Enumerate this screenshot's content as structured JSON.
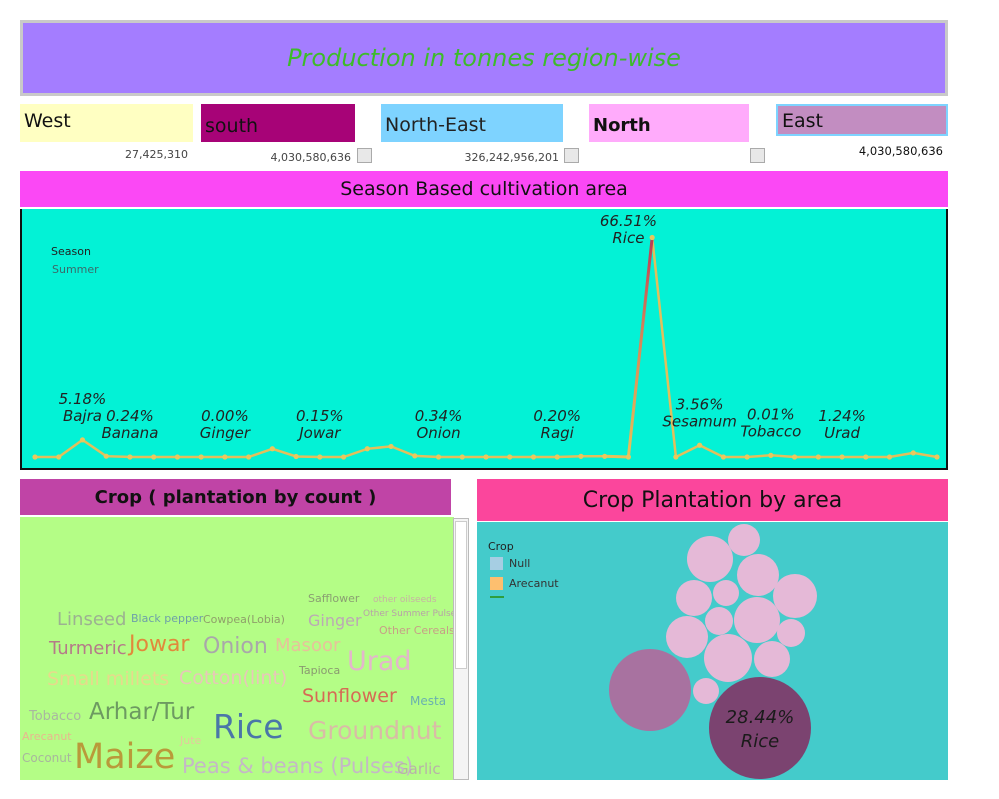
{
  "title": "Production in tonnes region-wise",
  "regions": [
    {
      "name": "West",
      "value": "27,425,310",
      "color": "#ffffc2"
    },
    {
      "name": "south",
      "value": "4,030,580,636",
      "color": "#a70377"
    },
    {
      "name": "North-East",
      "value": "326,242,956,201",
      "color": "#7ed3ff"
    },
    {
      "name": "North",
      "value": "",
      "color": "#ffabfb"
    },
    {
      "name": "East",
      "value": "4,030,580,636",
      "color": "#c28dc1"
    }
  ],
  "season_chart": {
    "header": "Season Based cultivation area",
    "legend_title": "Season",
    "legend_item": "Summer"
  },
  "chart_data": [
    {
      "type": "line",
      "title": "Season Based cultivation area",
      "ylabel": "",
      "xlabel": "",
      "ylim": [
        0,
        70
      ],
      "series": [
        {
          "values": [
            0,
            0,
            5.18,
            0.24,
            0,
            0,
            0,
            0,
            0,
            0,
            2.5,
            0.15,
            0,
            0,
            2.5,
            3.2,
            0.34,
            0,
            0,
            0,
            0,
            0,
            0,
            0.2,
            0.2,
            0,
            66.51,
            0,
            3.56,
            0,
            0,
            0.5,
            0,
            0,
            0.01,
            0,
            0,
            1.24,
            0
          ]
        }
      ],
      "labels": [
        {
          "index": 2,
          "percent": "5.18%",
          "crop": "Bajra"
        },
        {
          "index": 4,
          "percent": "0.24%",
          "crop": "Banana"
        },
        {
          "index": 8,
          "percent": "0.00%",
          "crop": "Ginger"
        },
        {
          "index": 12,
          "percent": "0.15%",
          "crop": "Jowar"
        },
        {
          "index": 17,
          "percent": "0.34%",
          "crop": "Onion"
        },
        {
          "index": 22,
          "percent": "0.20%",
          "crop": "Ragi"
        },
        {
          "index": 25,
          "percent": "66.51%",
          "crop": "Rice"
        },
        {
          "index": 28,
          "percent": "3.56%",
          "crop": "Sesamum"
        },
        {
          "index": 31,
          "percent": "0.01%",
          "crop": "Tobacco"
        },
        {
          "index": 34,
          "percent": "1.24%",
          "crop": "Urad"
        }
      ]
    },
    {
      "type": "bubble",
      "title": "Crop Plantation by area",
      "legend_title": "Crop",
      "legend": [
        {
          "name": "Null",
          "color": "#a6cee3"
        },
        {
          "name": "Arecanut",
          "color": "#fdbf6f"
        }
      ],
      "highlight": {
        "percent": "28.44%",
        "crop": "Rice"
      }
    }
  ],
  "crop_count": {
    "header": "Crop ( plantation by count )",
    "words": [
      {
        "text": "Safflower",
        "color": "#8a9f72"
      },
      {
        "text": "other oilseeds",
        "color": "#c7b2a3"
      },
      {
        "text": "Other Summer Pulses",
        "color": "#b8a2a7"
      },
      {
        "text": "Linseed",
        "color": "#9cb191"
      },
      {
        "text": "Black pepper",
        "color": "#6ea0a8"
      },
      {
        "text": "Cowpea(Lobia)",
        "color": "#8f9f6a"
      },
      {
        "text": "Ginger",
        "color": "#bba9b4"
      },
      {
        "text": "Other Cereals",
        "color": "#c79f86"
      },
      {
        "text": "Turmeric",
        "color": "#b57a88"
      },
      {
        "text": "Jowar",
        "color": "#e1893b"
      },
      {
        "text": "Onion",
        "color": "#a9a7aa"
      },
      {
        "text": "Masoor",
        "color": "#e6c29a"
      },
      {
        "text": "Urad",
        "color": "#e3b6cb"
      },
      {
        "text": "Tapioca",
        "color": "#8a9a70"
      },
      {
        "text": "Small millets",
        "color": "#e6da8c"
      },
      {
        "text": "Cotton(lint)",
        "color": "#e8c6b9"
      },
      {
        "text": "Sunflower",
        "color": "#d66a55"
      },
      {
        "text": "Mesta",
        "color": "#6ab0b0"
      },
      {
        "text": "Tobacco",
        "color": "#a9b6a0"
      },
      {
        "text": "Arhar/Tur",
        "color": "#6d9a61"
      },
      {
        "text": "Rice",
        "color": "#4a76a8"
      },
      {
        "text": "Groundnut",
        "color": "#d9bca6"
      },
      {
        "text": "Arecanut",
        "color": "#e8b78e"
      },
      {
        "text": "Jute",
        "color": "#e4c89e"
      },
      {
        "text": "Coconut",
        "color": "#a8b69d"
      },
      {
        "text": "Maize",
        "color": "#b99a3a"
      },
      {
        "text": "Peas & beans (Pulses)",
        "color": "#c4b8c6"
      },
      {
        "text": "Garlic",
        "color": "#b8b2a8"
      }
    ]
  }
}
